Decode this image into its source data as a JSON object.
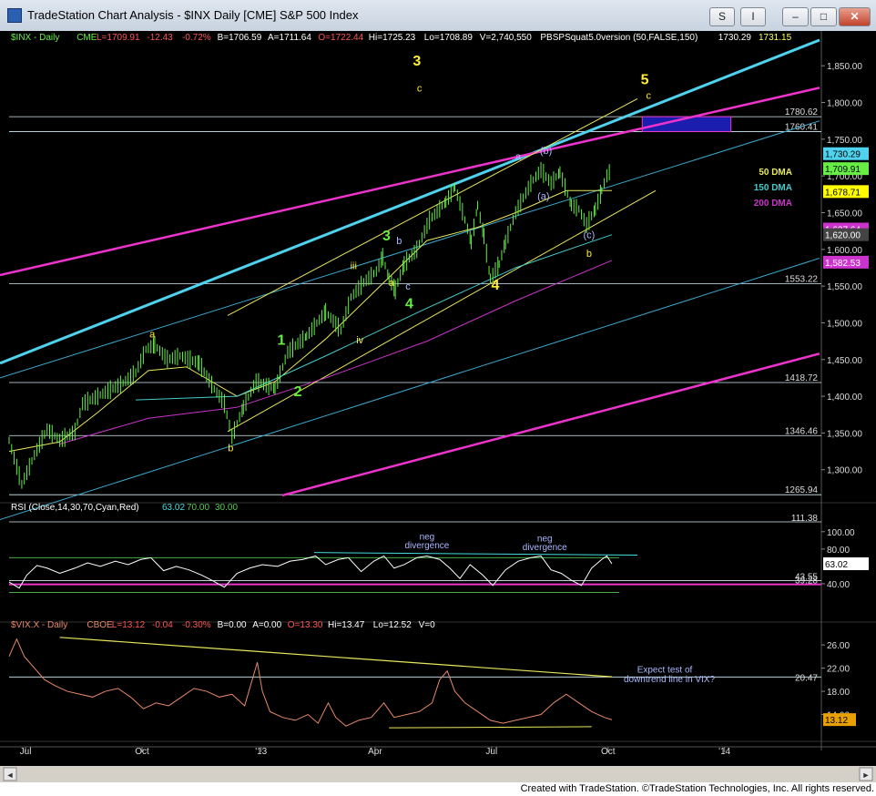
{
  "window": {
    "title": "TradeStation Chart Analysis - $INX Daily [CME] S&P 500 Index",
    "buttons": [
      "S",
      "I",
      "–",
      "□",
      "✕"
    ]
  },
  "colors": {
    "background": "#000000",
    "price_up": "#66ee44",
    "vix": "#e8896a",
    "channel_cyan": "#4fd2ee",
    "channel_magenta": "#ee33cc",
    "dma50": "#e8e85a",
    "dma150": "#44cccc",
    "dma200": "#cc33cc",
    "wave_labels": "#ffee33"
  },
  "chart_data": [
    {
      "type": "candlestick",
      "panel": "price",
      "header": {
        "symbol": "$INX - Daily",
        "exchange": "CME",
        "last": "L=1709.91",
        "change": "-12.43",
        "pct": "-0.72%",
        "bid": "B=1706.59",
        "ask": "A=1711.64",
        "open": "O=1722.44",
        "high": "Hi=1725.23",
        "low": "Lo=1708.89",
        "volume": "V=2,740,550",
        "study": "PBSPSquat5.0version (50,FALSE,150)",
        "study_v1": "1730.29",
        "study_v2": "1731.15"
      },
      "ylim": [
        1260,
        1880
      ],
      "y_ticks": [
        "1,850.00",
        "1,800.00",
        "1,750.00",
        "1,700.00",
        "1,650.00",
        "1,600.00",
        "1,550.00",
        "1,500.00",
        "1,450.00",
        "1,400.00",
        "1,350.00",
        "1,300.00"
      ],
      "y_tick_values": [
        1850,
        1800,
        1750,
        1700,
        1650,
        1600,
        1550,
        1500,
        1450,
        1400,
        1350,
        1300
      ],
      "x_ticks": [
        "Jul",
        "Oct",
        "'13",
        "Apr",
        "Jul",
        "Oct",
        "'14"
      ],
      "x_tick_days": [
        13,
        105,
        199,
        289,
        381,
        473,
        565
      ],
      "x_range_days": [
        0,
        640
      ],
      "last_bar_day": 476,
      "price_points": [
        [
          0,
          1340
        ],
        [
          10,
          1280
        ],
        [
          20,
          1320
        ],
        [
          30,
          1355
        ],
        [
          40,
          1340
        ],
        [
          52,
          1352
        ],
        [
          58,
          1390
        ],
        [
          70,
          1400
        ],
        [
          90,
          1418
        ],
        [
          100,
          1432
        ],
        [
          108,
          1464
        ],
        [
          115,
          1470
        ],
        [
          125,
          1450
        ],
        [
          135,
          1455
        ],
        [
          150,
          1445
        ],
        [
          162,
          1410
        ],
        [
          170,
          1390
        ],
        [
          176,
          1345
        ],
        [
          185,
          1385
        ],
        [
          195,
          1420
        ],
        [
          210,
          1410
        ],
        [
          220,
          1460
        ],
        [
          235,
          1482
        ],
        [
          250,
          1515
        ],
        [
          262,
          1490
        ],
        [
          270,
          1535
        ],
        [
          280,
          1555
        ],
        [
          290,
          1570
        ],
        [
          295,
          1590
        ],
        [
          300,
          1560
        ],
        [
          305,
          1545
        ],
        [
          312,
          1580
        ],
        [
          322,
          1600
        ],
        [
          332,
          1640
        ],
        [
          345,
          1665
        ],
        [
          352,
          1685
        ],
        [
          360,
          1640
        ],
        [
          365,
          1610
        ],
        [
          370,
          1660
        ],
        [
          375,
          1618
        ],
        [
          380,
          1560
        ],
        [
          387,
          1580
        ],
        [
          392,
          1610
        ],
        [
          400,
          1650
        ],
        [
          412,
          1690
        ],
        [
          420,
          1708
        ],
        [
          428,
          1690
        ],
        [
          435,
          1705
        ],
        [
          444,
          1660
        ],
        [
          450,
          1655
        ],
        [
          456,
          1633
        ],
        [
          463,
          1655
        ],
        [
          468,
          1680
        ],
        [
          472,
          1700
        ],
        [
          476,
          1710
        ]
      ],
      "moving_averages": [
        {
          "name": "50 DMA",
          "value": "1,709.91",
          "color": "#e8e85a",
          "points": [
            [
              0,
              1325
            ],
            [
              40,
              1338
            ],
            [
              70,
              1378
            ],
            [
              110,
              1435
            ],
            [
              140,
              1440
            ],
            [
              180,
              1400
            ],
            [
              210,
              1420
            ],
            [
              250,
              1478
            ],
            [
              290,
              1545
            ],
            [
              330,
              1612
            ],
            [
              370,
              1630
            ],
            [
              400,
              1650
            ],
            [
              440,
              1680
            ],
            [
              476,
              1680
            ]
          ]
        },
        {
          "name": "150 DMA",
          "value": "1,678.71",
          "color": "#44cccc",
          "points": [
            [
              100,
              1395
            ],
            [
              180,
              1400
            ],
            [
              250,
              1455
            ],
            [
              330,
              1520
            ],
            [
              400,
              1575
            ],
            [
              476,
              1620
            ]
          ]
        },
        {
          "name": "200 DMA",
          "value": "1,627.64",
          "color": "#cc33cc",
          "points": [
            [
              40,
              1335
            ],
            [
              110,
              1370
            ],
            [
              180,
              1385
            ],
            [
              250,
              1425
            ],
            [
              330,
              1475
            ],
            [
              400,
              1530
            ],
            [
              476,
              1585
            ]
          ]
        }
      ],
      "price_labels": [
        "1,730.29",
        "1,709.91",
        "1,678.71",
        "1,627.64",
        "1,620.00",
        "1,582.53"
      ],
      "price_label_values": [
        1730.29,
        1709.91,
        1678.71,
        1627.64,
        1620.0,
        1582.53
      ],
      "price_label_colors": [
        "#4fd2ee",
        "#66ee44",
        "#ffff00",
        "#cc33cc",
        "#444444",
        "#cc33cc"
      ],
      "horizontal_lines": [
        {
          "label": "1780.62",
          "value": 1780.62
        },
        {
          "label": "1760.41",
          "value": 1760.41
        },
        {
          "label": "1553.22",
          "value": 1553.22
        },
        {
          "label": "1418.72",
          "value": 1418.72
        },
        {
          "label": "1346.46",
          "value": 1346.46
        },
        {
          "label": "1265.94",
          "value": 1265.94
        }
      ],
      "target_box": {
        "day_from": 500,
        "day_to": 570,
        "low": 1760.41,
        "high": 1780.62
      },
      "wave_labels": [
        {
          "text": "a",
          "day": 113,
          "value": 1480
        },
        {
          "text": "b",
          "day": 175,
          "value": 1325
        },
        {
          "text": "1",
          "day": 215,
          "value": 1470
        },
        {
          "text": "2",
          "day": 228,
          "value": 1400
        },
        {
          "text": "3",
          "day": 322,
          "value": 1850
        },
        {
          "text": "c",
          "day": 324,
          "value": 1815
        },
        {
          "text": "iii",
          "day": 272,
          "value": 1573
        },
        {
          "text": "iv",
          "day": 277,
          "value": 1472
        },
        {
          "text": "3",
          "day": 298,
          "value": 1612
        },
        {
          "text": "b",
          "day": 308,
          "value": 1607
        },
        {
          "text": "a",
          "day": 302,
          "value": 1550
        },
        {
          "text": "c",
          "day": 315,
          "value": 1545
        },
        {
          "text": "4",
          "day": 316,
          "value": 1520
        },
        {
          "text": "4",
          "day": 384,
          "value": 1545
        },
        {
          "text": "a",
          "day": 402,
          "value": 1722
        },
        {
          "text": "(b)",
          "day": 424,
          "value": 1730
        },
        {
          "text": "(a)",
          "day": 422,
          "value": 1668
        },
        {
          "text": "(c)",
          "day": 458,
          "value": 1615
        },
        {
          "text": "b",
          "day": 458,
          "value": 1590
        },
        {
          "text": "5",
          "day": 502,
          "value": 1825
        },
        {
          "text": "c",
          "day": 505,
          "value": 1805
        }
      ],
      "dma_legend": [
        "50 DMA",
        "150 DMA",
        "200 DMA"
      ]
    },
    {
      "type": "line",
      "panel": "rsi",
      "header": {
        "name": "RSI (Close,14,30,70,Cyan,Red)",
        "value": "63.02",
        "overbought": "70.00",
        "oversold": "30.00"
      },
      "ylim": [
        0,
        125
      ],
      "y_ticks": [
        "100.00",
        "80.00",
        "40.00"
      ],
      "y_tick_values": [
        100,
        80,
        40
      ],
      "horizontal_lines": [
        {
          "label": "111.38",
          "value": 111.38
        },
        {
          "label": "43.55",
          "value": 43.55
        },
        {
          "label": "39.28",
          "value": 39.28
        }
      ],
      "current_label": "63.02",
      "annotations": [
        {
          "text": "neg",
          "day": 330,
          "value": 91
        },
        {
          "text": "divergence",
          "day": 330,
          "value": 81
        },
        {
          "text": "neg",
          "day": 423,
          "value": 89
        },
        {
          "text": "divergence",
          "day": 423,
          "value": 79
        }
      ],
      "series": [
        [
          0,
          42
        ],
        [
          8,
          35
        ],
        [
          14,
          50
        ],
        [
          22,
          61
        ],
        [
          30,
          58
        ],
        [
          40,
          52
        ],
        [
          52,
          58
        ],
        [
          62,
          64
        ],
        [
          72,
          60
        ],
        [
          84,
          66
        ],
        [
          94,
          62
        ],
        [
          104,
          68
        ],
        [
          112,
          70
        ],
        [
          122,
          55
        ],
        [
          132,
          60
        ],
        [
          142,
          56
        ],
        [
          152,
          50
        ],
        [
          160,
          44
        ],
        [
          170,
          36
        ],
        [
          180,
          52
        ],
        [
          190,
          58
        ],
        [
          200,
          62
        ],
        [
          212,
          60
        ],
        [
          222,
          66
        ],
        [
          232,
          68
        ],
        [
          242,
          72
        ],
        [
          250,
          62
        ],
        [
          260,
          68
        ],
        [
          268,
          70
        ],
        [
          278,
          54
        ],
        [
          288,
          66
        ],
        [
          296,
          72
        ],
        [
          304,
          58
        ],
        [
          312,
          62
        ],
        [
          322,
          70
        ],
        [
          330,
          72
        ],
        [
          340,
          68
        ],
        [
          348,
          58
        ],
        [
          356,
          46
        ],
        [
          364,
          62
        ],
        [
          374,
          50
        ],
        [
          382,
          38
        ],
        [
          392,
          56
        ],
        [
          402,
          66
        ],
        [
          412,
          70
        ],
        [
          420,
          72
        ],
        [
          428,
          56
        ],
        [
          436,
          52
        ],
        [
          444,
          44
        ],
        [
          452,
          38
        ],
        [
          460,
          58
        ],
        [
          468,
          68
        ],
        [
          472,
          72
        ],
        [
          476,
          63
        ]
      ]
    },
    {
      "type": "line",
      "panel": "vix",
      "header": {
        "symbol": "$VIX.X - Daily",
        "exchange": "CBOE",
        "last": "L=13.12",
        "change": "-0.04",
        "pct": "-0.30%",
        "bid": "B=0.00",
        "ask": "A=0.00",
        "open": "O=13.30",
        "high": "Hi=13.47",
        "low": "Lo=12.52",
        "volume": "V=0"
      },
      "ylim": [
        10,
        29
      ],
      "y_ticks": [
        "26.00",
        "22.00",
        "18.00",
        "14.00"
      ],
      "y_tick_values": [
        26,
        22,
        18,
        14
      ],
      "horizontal_lines": [
        {
          "label": "20.47",
          "value": 20.47
        }
      ],
      "current_label": "13.12",
      "annotation": [
        "Expect test of",
        "downtrend line in VIX?"
      ],
      "series": [
        [
          0,
          24
        ],
        [
          6,
          27
        ],
        [
          12,
          24
        ],
        [
          20,
          22
        ],
        [
          28,
          20
        ],
        [
          36,
          19
        ],
        [
          46,
          18
        ],
        [
          56,
          17.5
        ],
        [
          66,
          17
        ],
        [
          76,
          18
        ],
        [
          86,
          18.5
        ],
        [
          96,
          17
        ],
        [
          106,
          15
        ],
        [
          116,
          16
        ],
        [
          126,
          15.5
        ],
        [
          136,
          17
        ],
        [
          146,
          18.5
        ],
        [
          156,
          18
        ],
        [
          166,
          17
        ],
        [
          176,
          17.5
        ],
        [
          186,
          15.5
        ],
        [
          196,
          23
        ],
        [
          200,
          18
        ],
        [
          206,
          14.5
        ],
        [
          216,
          13.5
        ],
        [
          226,
          13
        ],
        [
          236,
          14
        ],
        [
          244,
          12.5
        ],
        [
          252,
          16
        ],
        [
          258,
          13.5
        ],
        [
          266,
          12
        ],
        [
          276,
          13
        ],
        [
          286,
          13.5
        ],
        [
          296,
          16
        ],
        [
          304,
          13.5
        ],
        [
          314,
          14
        ],
        [
          324,
          14.5
        ],
        [
          334,
          16
        ],
        [
          340,
          20
        ],
        [
          346,
          21.5
        ],
        [
          352,
          18
        ],
        [
          360,
          16
        ],
        [
          370,
          14.5
        ],
        [
          380,
          13
        ],
        [
          390,
          12.5
        ],
        [
          400,
          13
        ],
        [
          410,
          13.5
        ],
        [
          420,
          14
        ],
        [
          430,
          16
        ],
        [
          440,
          17.5
        ],
        [
          450,
          16
        ],
        [
          460,
          14.5
        ],
        [
          470,
          13.5
        ],
        [
          476,
          13.1
        ]
      ]
    }
  ],
  "footer": "Created with TradeStation. ©TradeStation Technologies, Inc. All rights reserved."
}
